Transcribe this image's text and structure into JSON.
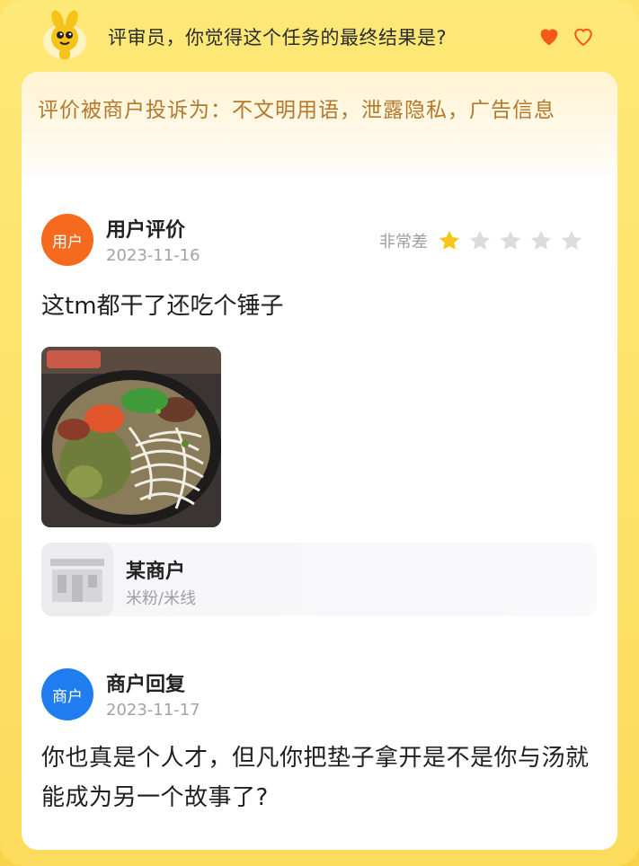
{
  "header": {
    "question": "评审员，你觉得这个任务的最终结果是?",
    "mascot_icon": "mascot-icon",
    "heart_filled_icon": "heart-filled-icon",
    "heart_outline_icon": "heart-outline-icon",
    "accent_color": "#f5591a"
  },
  "complaint": {
    "text": "评价被商户投诉为：不文明用语，泄露隐私，广告信息"
  },
  "review": {
    "avatar_label": "用户",
    "title": "用户评价",
    "date": "2023-11-16",
    "rating_label": "非常差",
    "rating": 1,
    "rating_max": 5,
    "text": "这tm都干了还吃个锤子",
    "photo": "noodle-bowl-photo"
  },
  "shop": {
    "name": "某商户",
    "category": "米粉/米线",
    "icon": "storefront-icon"
  },
  "reply": {
    "avatar_label": "商户",
    "title": "商户回复",
    "date": "2023-11-17",
    "text": "你也真是个人才，但凡你把垫子拿开是不是你与汤就能成为另一个故事了?"
  },
  "colors": {
    "user_avatar": "#f56a1f",
    "merchant_avatar": "#1f7df0",
    "complaint_text": "#b3782b",
    "star_active": "#f5c518",
    "star_inactive": "#dcdcdc"
  }
}
